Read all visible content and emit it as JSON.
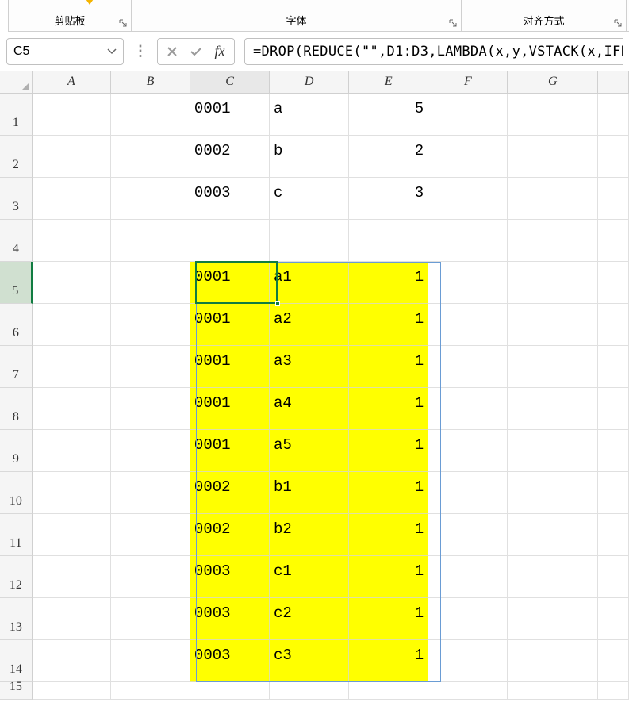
{
  "ribbon": {
    "group1_label": "剪贴板",
    "group2_label": "字体",
    "group3_label": "对齐方式"
  },
  "namebox": {
    "value": "C5"
  },
  "formula": "=DROP(REDUCE(\"\",D1:D3,LAMBDA(x,y,VSTACK(x,IFE",
  "columns": [
    "A",
    "B",
    "C",
    "D",
    "E",
    "F",
    "G",
    ""
  ],
  "rows": [
    {
      "n": "1",
      "cells": {
        "C": "0001",
        "D": "a",
        "E": "5",
        "E_align": "right"
      }
    },
    {
      "n": "2",
      "cells": {
        "C": "0002",
        "D": "b",
        "E": "2",
        "E_align": "right"
      }
    },
    {
      "n": "3",
      "cells": {
        "C": "0003",
        "D": "c",
        "E": "3",
        "E_align": "right"
      }
    },
    {
      "n": "4",
      "cells": {}
    },
    {
      "n": "5",
      "cells": {
        "C": "0001",
        "D": "a1",
        "E": "1",
        "E_align": "right",
        "yellow": true
      }
    },
    {
      "n": "6",
      "cells": {
        "C": "0001",
        "D": "a2",
        "E": "1",
        "E_align": "right",
        "yellow": true
      }
    },
    {
      "n": "7",
      "cells": {
        "C": "0001",
        "D": "a3",
        "E": "1",
        "E_align": "right",
        "yellow": true
      }
    },
    {
      "n": "8",
      "cells": {
        "C": "0001",
        "D": "a4",
        "E": "1",
        "E_align": "right",
        "yellow": true
      }
    },
    {
      "n": "9",
      "cells": {
        "C": "0001",
        "D": "a5",
        "E": "1",
        "E_align": "right",
        "yellow": true
      }
    },
    {
      "n": "10",
      "cells": {
        "C": "0002",
        "D": "b1",
        "E": "1",
        "E_align": "right",
        "yellow": true
      }
    },
    {
      "n": "11",
      "cells": {
        "C": "0002",
        "D": "b2",
        "E": "1",
        "E_align": "right",
        "yellow": true
      }
    },
    {
      "n": "12",
      "cells": {
        "C": "0003",
        "D": "c1",
        "E": "1",
        "E_align": "right",
        "yellow": true
      }
    },
    {
      "n": "13",
      "cells": {
        "C": "0003",
        "D": "c2",
        "E": "1",
        "E_align": "right",
        "yellow": true
      }
    },
    {
      "n": "14",
      "cells": {
        "C": "0003",
        "D": "c3",
        "E": "1",
        "E_align": "right",
        "yellow": true
      }
    },
    {
      "n": "15",
      "cells": {}
    }
  ],
  "active_cell_col": "C",
  "active_row": "5"
}
